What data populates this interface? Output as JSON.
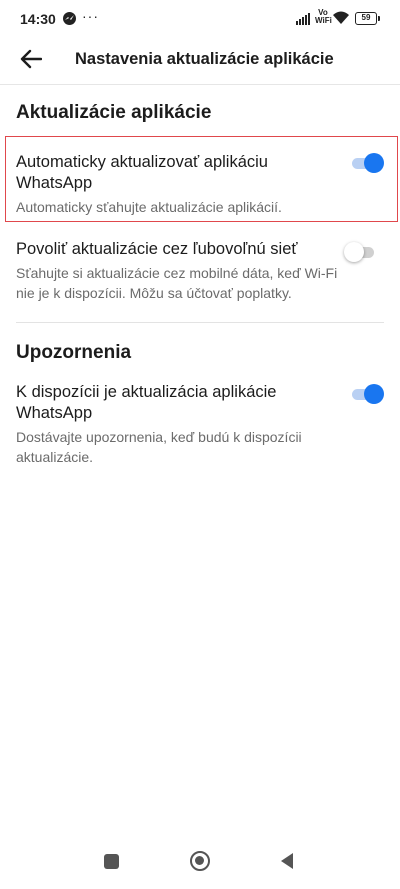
{
  "status_bar": {
    "time": "14:30",
    "more_indicator": "···",
    "network_label": "Vo WiFi",
    "battery_level": "59",
    "icons": [
      "messenger-icon",
      "signal-icon",
      "wifi-icon",
      "battery-icon"
    ]
  },
  "app_bar": {
    "title": "Nastavenia aktualizácie aplikácie",
    "back_icon": "arrow-left-icon"
  },
  "sections": {
    "app_updates": {
      "title": "Aktualizácie aplikácie",
      "auto_update": {
        "label": "Automaticky aktualizovať aplikáciu WhatsApp",
        "description": "Automaticky sťahujte aktualizácie aplikácií.",
        "enabled": true
      },
      "any_network": {
        "label": "Povoliť aktualizácie cez ľubovoľnú sieť",
        "description": "Sťahujte si aktualizácie cez mobilné dáta, keď Wi-Fi nie je k dispozícii. Môžu sa účtovať poplatky.",
        "enabled": false
      }
    },
    "notifications": {
      "title": "Upozornenia",
      "update_available": {
        "label": "K dispozícii je aktualizácia aplikácie WhatsApp",
        "description": "Dostávajte upozornenia, keď budú k dispozícii aktualizácie.",
        "enabled": true
      }
    }
  },
  "colors": {
    "accent": "#1976f0",
    "highlight_border": "#e0474c"
  },
  "nav_bar": {
    "icons": [
      "recents-icon",
      "home-icon",
      "back-icon"
    ]
  }
}
